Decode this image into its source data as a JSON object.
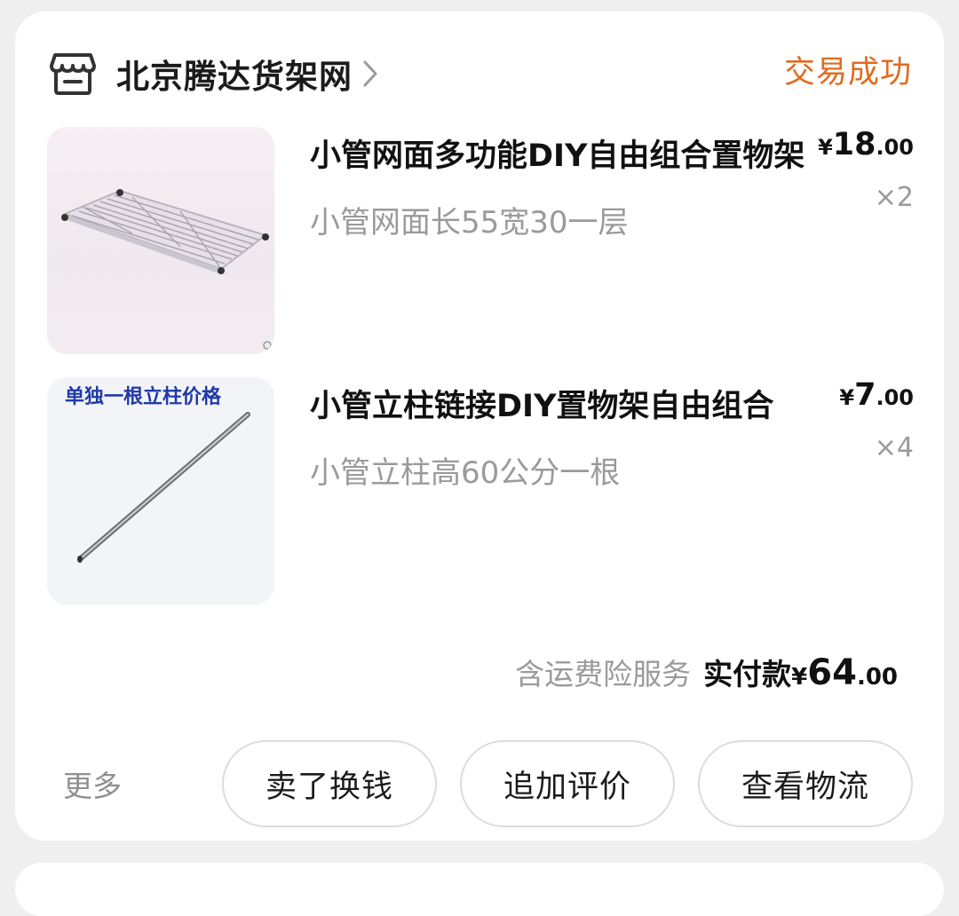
{
  "order": {
    "shop_name": "北京腾达货架网",
    "status": "交易成功",
    "items": [
      {
        "title": "小管网面多功能DIY自由组合置物架",
        "spec": "小管网面长55宽30一层",
        "price_currency": "¥",
        "price_int": "18",
        "price_dec": ".00",
        "quantity": "×2"
      },
      {
        "title": "小管立柱链接DIY置物架自由组合",
        "spec": "小管立柱高60公分一根",
        "price_currency": "¥",
        "price_int": "7",
        "price_dec": ".00",
        "quantity": "×4",
        "thumb_caption": "单独一根立柱价格"
      }
    ],
    "total": {
      "note": "含运费险服务",
      "label": "实付款",
      "currency": "¥",
      "int": "64",
      "dec": ".00"
    },
    "actions": {
      "more": "更多",
      "sell": "卖了换钱",
      "review": "追加评价",
      "logistics": "查看物流"
    }
  },
  "icons": {
    "shop": "store-icon",
    "chevron": "chevron-right-icon"
  },
  "colors": {
    "status": "#e06b1f",
    "caption": "#1f3aa8"
  }
}
